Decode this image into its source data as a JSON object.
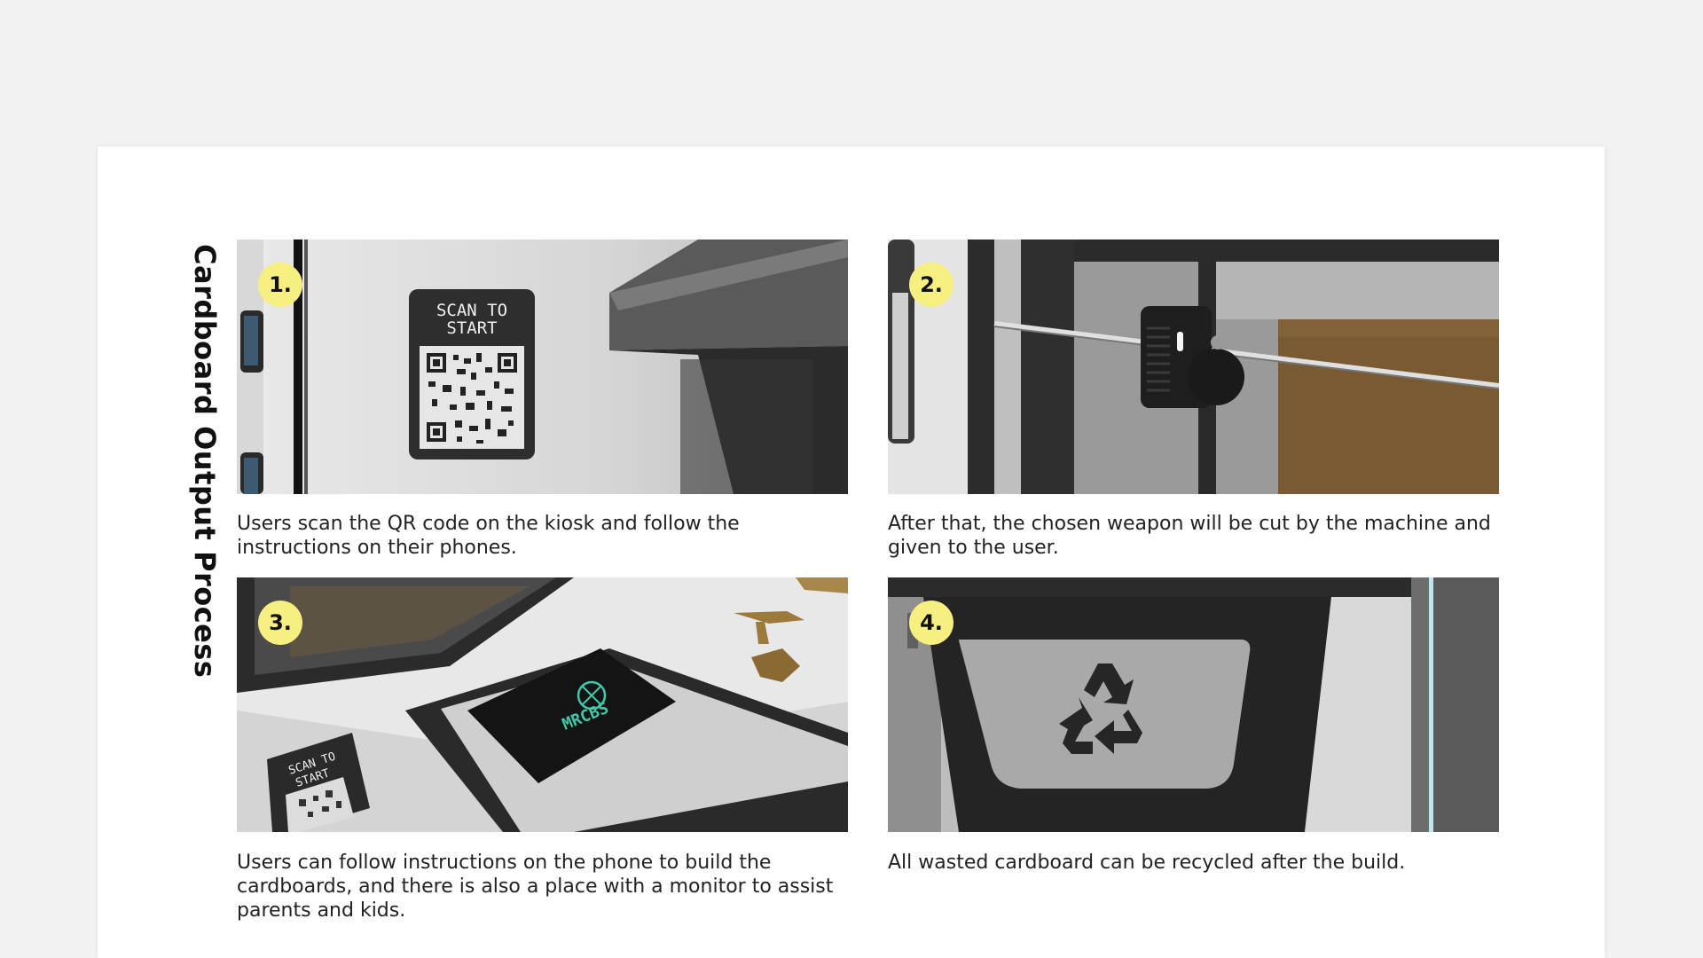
{
  "page": {
    "title": "Cardboard Output Process"
  },
  "steps": [
    {
      "number": "1.",
      "caption": "Users scan the QR code on the kiosk and follow the instructions on their phones.",
      "image_text": "SCAN TO START"
    },
    {
      "number": "2.",
      "caption": "After that, the chosen weapon will be cut by the machine and given to the user."
    },
    {
      "number": "3.",
      "caption": "Users can follow instructions on the phone to build the cardboards, and there is also a place with a monitor to assist parents and kids.",
      "image_text": "SCAN TO START",
      "screen_text": "MRCBS"
    },
    {
      "number": "4.",
      "caption": "All wasted cardboard can be recycled after the build."
    }
  ],
  "colors": {
    "background": "#f2f2f2",
    "card": "#ffffff",
    "badge": "#f7ef80",
    "text": "#222222"
  },
  "icons": {
    "recycle": "recycle-icon",
    "qr": "qr-code-icon"
  }
}
